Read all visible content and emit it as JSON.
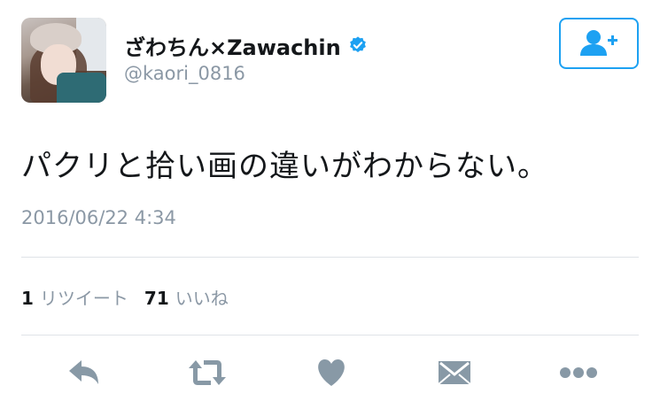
{
  "user": {
    "display_name": "ざわちん×Zawachin",
    "handle": "@kaori_0816",
    "verified": true
  },
  "tweet": {
    "text": "パクリと拾い画の違いがわからない。",
    "timestamp": "2016/06/22 4:34"
  },
  "stats": {
    "retweets_count": "1",
    "retweets_label": "リツイート",
    "likes_count": "71",
    "likes_label": "いいね"
  },
  "icons": {
    "follow": "add-user-icon",
    "reply": "reply-icon",
    "retweet": "retweet-icon",
    "like": "heart-icon",
    "message": "envelope-icon",
    "more": "more-icon"
  },
  "colors": {
    "accent": "#1da1f2",
    "action_gray": "#8899a6",
    "secondary_text": "#8b98a5"
  }
}
